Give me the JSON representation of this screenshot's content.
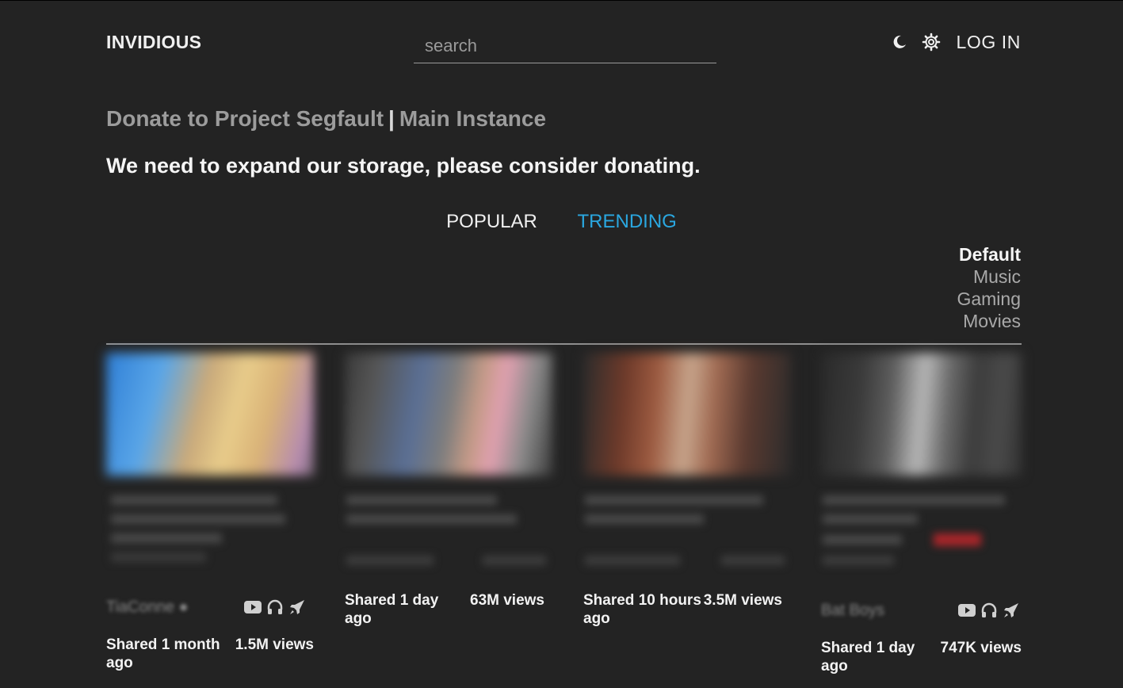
{
  "header": {
    "brand": "INVIDIOUS",
    "search_placeholder": "search",
    "theme_icon": "moon-icon",
    "settings_icon": "gear-icon",
    "login_label": "LOG IN"
  },
  "banner": {
    "donate_link": "Donate to Project Segfault",
    "separator": "|",
    "instance_link": "Main Instance",
    "message": "We need to expand our storage, please consider donating."
  },
  "tabs": [
    {
      "label": "POPULAR",
      "active": false
    },
    {
      "label": "TRENDING",
      "active": true
    }
  ],
  "categories": [
    {
      "label": "Default",
      "active": true
    },
    {
      "label": "Music",
      "active": false
    },
    {
      "label": "Gaming",
      "active": false
    },
    {
      "label": "Movies",
      "active": false
    }
  ],
  "colors": {
    "background": "#232323",
    "accent": "#2aa7e0",
    "text": "#f0f0f0",
    "muted": "#9c9c9c"
  },
  "videos": [
    {
      "shared": "Shared 1 month ago",
      "views": "1.5M views",
      "has_channel_row": true,
      "channel_icons": [
        "youtube-icon",
        "headphones-icon",
        "rocket-icon"
      ]
    },
    {
      "shared": "Shared 1 day ago",
      "views": "63M views",
      "has_channel_row": false
    },
    {
      "shared": "Shared 10 hours ago",
      "views": "3.5M views",
      "has_channel_row": false
    },
    {
      "shared": "Shared 1 day ago",
      "views": "747K views",
      "has_channel_row": true,
      "channel_icons": [
        "youtube-icon",
        "headphones-icon",
        "rocket-icon"
      ]
    }
  ]
}
